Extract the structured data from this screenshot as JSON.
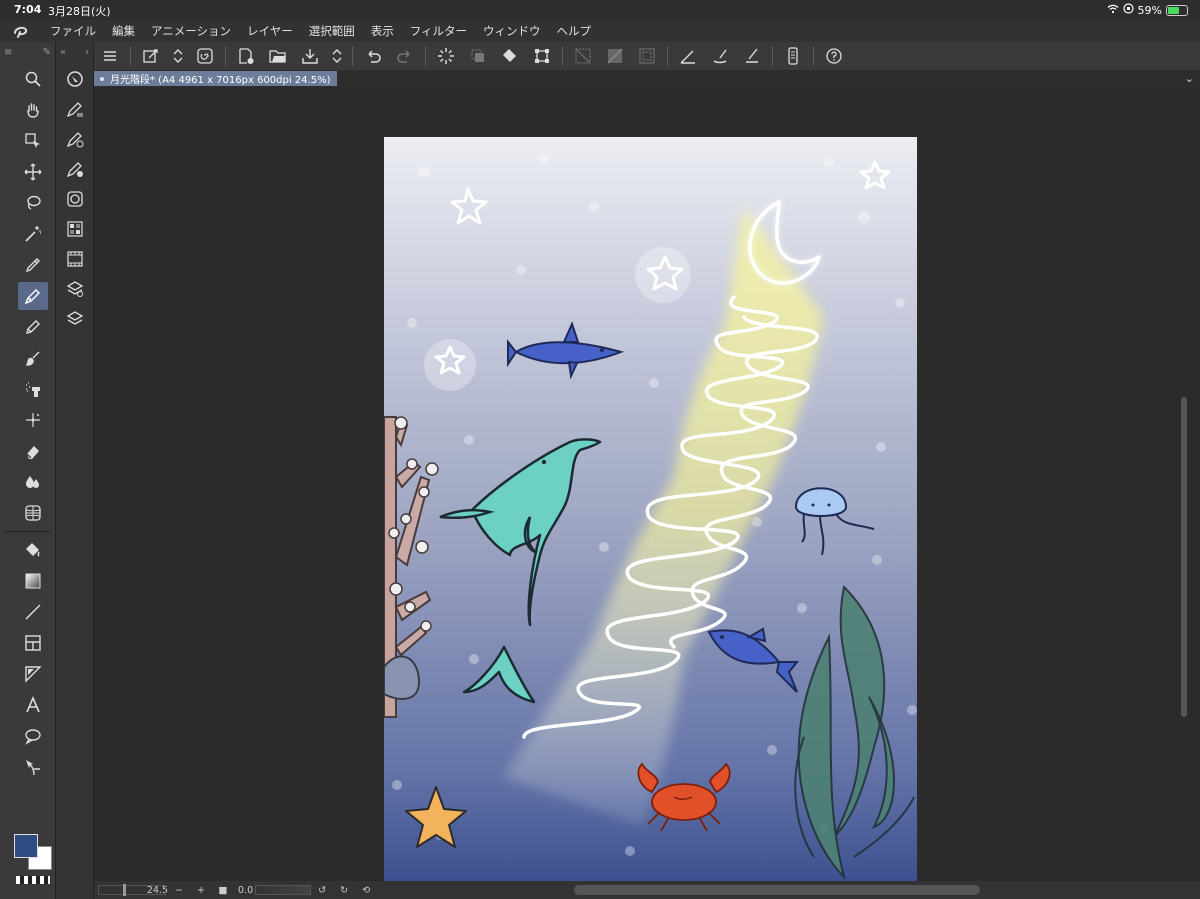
{
  "status_bar": {
    "time": "7:04",
    "date": "3月28日(火)",
    "battery_percent": "59%",
    "battery_level": 0.59
  },
  "menu": [
    "ファイル",
    "編集",
    "アニメーション",
    "レイヤー",
    "選択範囲",
    "表示",
    "フィルター",
    "ウィンドウ",
    "ヘルプ"
  ],
  "tab": {
    "title": "月光階段* (A4 4961 x 7016px 600dpi 24.5%)"
  },
  "bottom_bar": {
    "zoom": "24.5",
    "rotation": "0.0"
  },
  "colors": {
    "main_color": "#2e4b82",
    "sub_color": "#ffffff",
    "active_tool_bg": "#5a6a8a"
  },
  "tools": [
    "zoom-icon",
    "hand-icon",
    "object-select-icon",
    "move-icon",
    "lasso-icon",
    "magic-wand-icon",
    "eyedropper-icon",
    "pen-icon",
    "pencil-icon",
    "brush-icon",
    "airbrush-icon",
    "decoration-icon",
    "eraser-icon",
    "blend-icon",
    "mesh-transform-icon",
    "fill-icon",
    "gradient-icon",
    "line-icon",
    "frame-icon",
    "ruler-icon",
    "text-icon",
    "balloon-icon",
    "correct-line-icon"
  ],
  "active_tool": "pen-icon"
}
